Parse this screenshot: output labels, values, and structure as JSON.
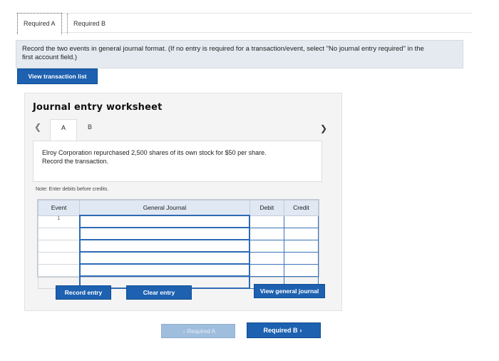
{
  "tabs": {
    "required_a": "Required A",
    "required_b": "Required B"
  },
  "instructions": {
    "line1": "Record the two events in general journal format. (If no entry is required for a transaction/event, select \"No journal entry required\" in the",
    "line2": "first account field.)"
  },
  "buttons": {
    "view_transaction_list": "View transaction list",
    "record_entry": "Record entry",
    "clear_entry": "Clear entry",
    "view_general_journal": "View general journal"
  },
  "worksheet": {
    "title": "Journal entry worksheet",
    "inner_tabs": [
      "A",
      "B"
    ],
    "scenario_line1": "Elroy Corporation repurchased 2,500 shares of its own stock for $50 per share.",
    "scenario_line2": "Record the transaction.",
    "note": "Note: Enter debits before credits."
  },
  "table": {
    "headers": [
      "Event",
      "General Journal",
      "Debit",
      "Credit"
    ],
    "event_number": "1"
  },
  "nav": {
    "prev_label": "Required A",
    "next_label": "Required B"
  },
  "icons": {
    "left": "chevron-left-icon",
    "right": "chevron-right-icon"
  },
  "colors": {
    "accent": "#1d61b0",
    "instruction_bg": "#e4eaf0",
    "table_header_bg": "#dfe8f3"
  }
}
